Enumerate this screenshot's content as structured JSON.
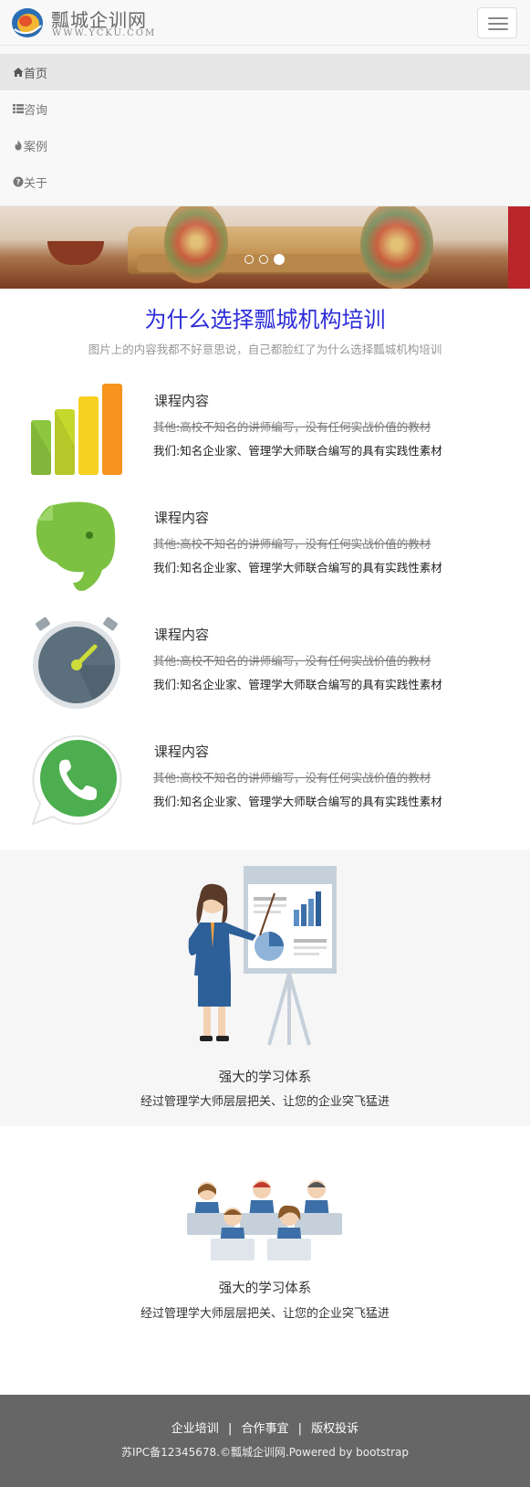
{
  "brand": {
    "title": "瓢城企训网",
    "subtitle": "WWW.YCKU.COM"
  },
  "menu": {
    "items": [
      {
        "label": "首页",
        "icon": "home-icon",
        "active": true
      },
      {
        "label": "咨询",
        "icon": "list-icon",
        "active": false
      },
      {
        "label": "案例",
        "icon": "fire-icon",
        "active": false
      },
      {
        "label": "关于",
        "icon": "question-circle-icon",
        "active": false
      }
    ]
  },
  "carousel": {
    "slide_count": 3,
    "active_index": 3
  },
  "why": {
    "title": "为什么选择瓢城机构培训",
    "subtitle": "图片上的内容我都不好意思说，自己都脸红了为什么选择瓢城机构培训"
  },
  "features": [
    {
      "icon": "bar-chart-icon",
      "title": "课程内容",
      "old": "其他:高校不知名的讲师编写，没有任何实战价值的教材",
      "new": "我们:知名企业家、管理学大师联合编写的具有实践性素材"
    },
    {
      "icon": "elephant-icon",
      "title": "课程内容",
      "old": "其他:高校不知名的讲师编写，没有任何实战价值的教材",
      "new": "我们:知名企业家、管理学大师联合编写的具有实践性素材"
    },
    {
      "icon": "stopwatch-icon",
      "title": "课程内容",
      "old": "其他:高校不知名的讲师编写，没有任何实战价值的教材",
      "new": "我们:知名企业家、管理学大师联合编写的具有实践性素材"
    },
    {
      "icon": "phone-chat-icon",
      "title": "课程内容",
      "old": "其他:高校不知名的讲师编写，没有任何实战价值的教材",
      "new": "我们:知名企业家、管理学大师联合编写的具有实践性素材"
    }
  ],
  "panels": [
    {
      "title": "强大的学习体系",
      "desc": "经过管理学大师层层把关、让您的企业突飞猛进"
    },
    {
      "title": "强大的学习体系",
      "desc": "经过管理学大师层层把关、让您的企业突飞猛进"
    }
  ],
  "footer": {
    "links": [
      "企业培训",
      "合作事宜",
      "版权投诉"
    ],
    "separator": "|",
    "copyright": "苏IPC备12345678.©瓢城企训网.Powered by bootstrap"
  }
}
